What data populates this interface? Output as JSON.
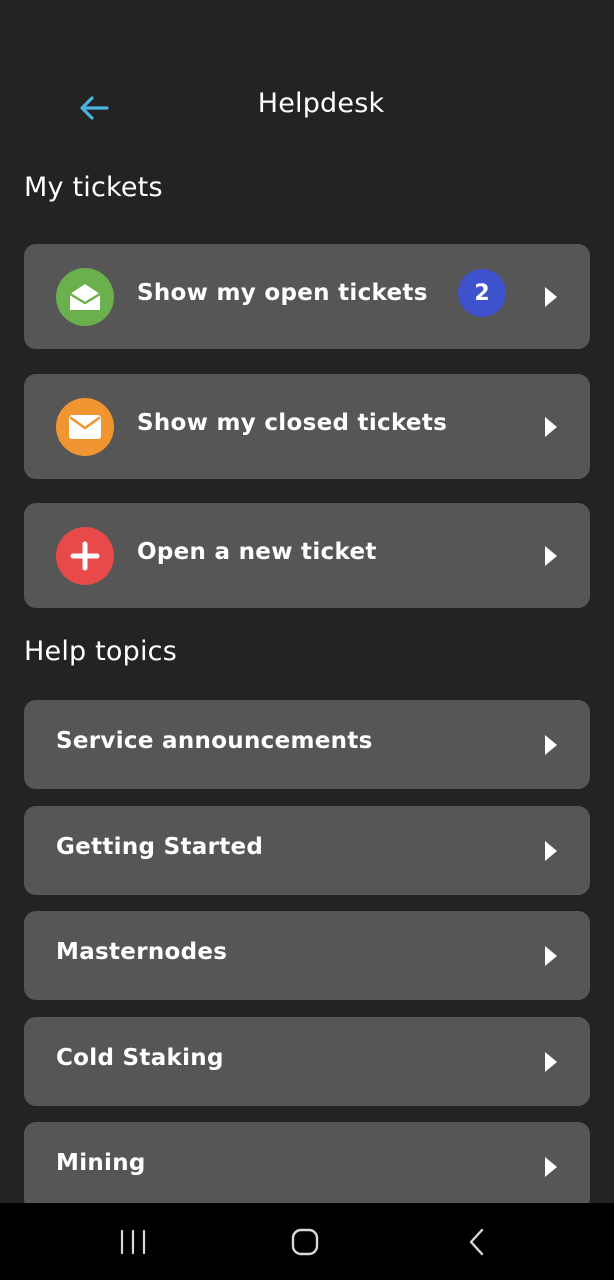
{
  "header": {
    "title": "Helpdesk",
    "back_icon": "arrow-left-icon",
    "back_color": "#4ab3e0"
  },
  "my_tickets": {
    "heading": "My tickets",
    "items": [
      {
        "label": "Show my open tickets",
        "icon": "envelope-open-icon",
        "icon_bg": "#6ab04c",
        "badge": "2",
        "badge_color": "#3d52cc"
      },
      {
        "label": "Show my closed tickets",
        "icon": "envelope-icon",
        "icon_bg": "#f0952f"
      },
      {
        "label": "Open a new ticket",
        "icon": "plus-icon",
        "icon_bg": "#e84a4a"
      }
    ]
  },
  "help_topics": {
    "heading": "Help topics",
    "items": [
      {
        "label": "Service announcements"
      },
      {
        "label": "Getting Started"
      },
      {
        "label": "Masternodes"
      },
      {
        "label": "Cold Staking"
      },
      {
        "label": "Mining"
      }
    ]
  },
  "system_nav": {
    "recent_icon": "recent-apps-icon",
    "home_icon": "home-icon",
    "back_icon": "back-icon"
  }
}
